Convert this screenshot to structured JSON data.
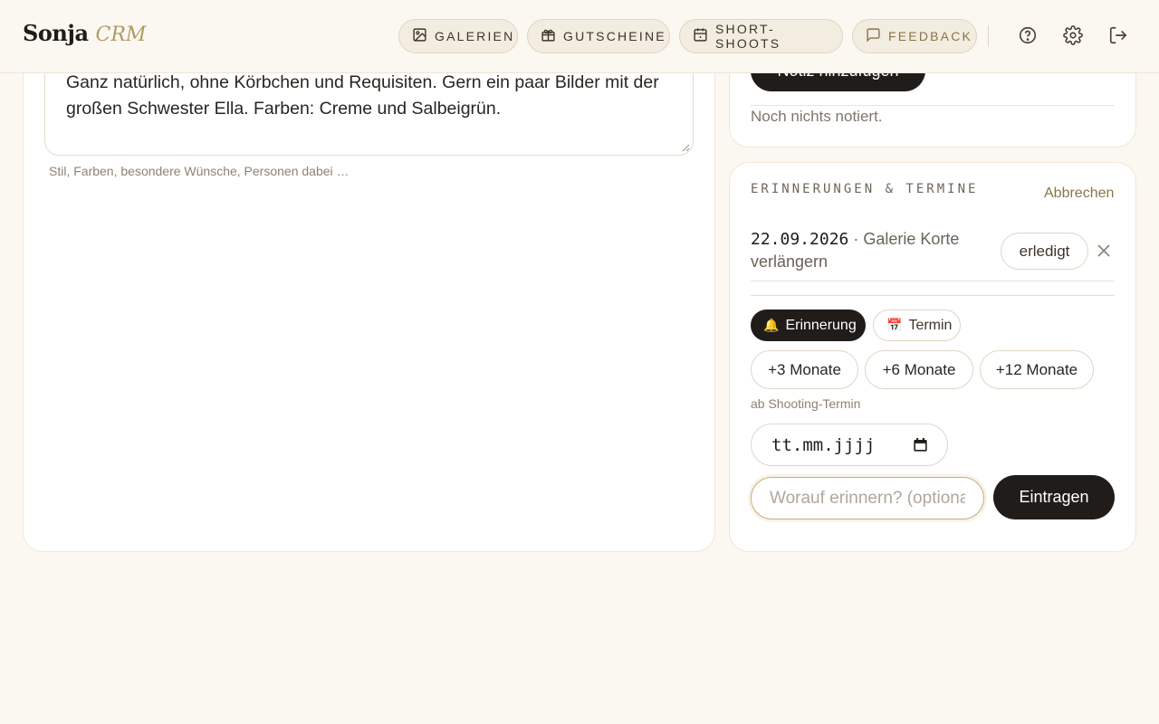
{
  "header": {
    "logo_main": "Sonja",
    "logo_sub": "CRM",
    "nav": [
      {
        "label": "Galerien",
        "icon": "image-icon"
      },
      {
        "label": "Gutscheine",
        "icon": "gift-icon"
      },
      {
        "label": "Short-Shoots",
        "icon": "calendar-icon"
      },
      {
        "label": "Feedback",
        "icon": "message-icon"
      }
    ],
    "icons": [
      "help-icon",
      "settings-icon",
      "logout-icon"
    ]
  },
  "wishes": {
    "text": "Ganz natürlich, ohne Körbchen und Requisiten. Gern ein paar Bilder mit der großen Schwester Ella. Farben: Creme und Salbeigrün.",
    "hint": "Stil, Farben, besondere Wünsche, Personen dabei …"
  },
  "notes": {
    "add_button": "Notiz hinzufügen",
    "empty": "Noch nichts notiert."
  },
  "reminders": {
    "title": "ERINNERUNGEN & TERMINE",
    "cancel": "Abbrechen",
    "items": [
      {
        "date": "22.09.2026",
        "separator": " · ",
        "text": "Galerie Korte verlängern",
        "done_label": "erledigt"
      }
    ],
    "type_toggle": [
      {
        "emoji": "🔔",
        "label": "Erinnerung",
        "active": true
      },
      {
        "emoji": "📅",
        "label": "Termin",
        "active": false
      }
    ],
    "quick": [
      "+3 Monate",
      "+6 Monate",
      "+12 Monate"
    ],
    "quick_hint": "ab Shooting-Termin",
    "date_placeholder": "tt.mm.jjjj",
    "text_placeholder": "Worauf erinnern? (optional)",
    "submit": "Eintragen"
  },
  "colors": {
    "accent": "#b29a63",
    "dark": "#1f1c19",
    "background": "#fbf8f2"
  }
}
